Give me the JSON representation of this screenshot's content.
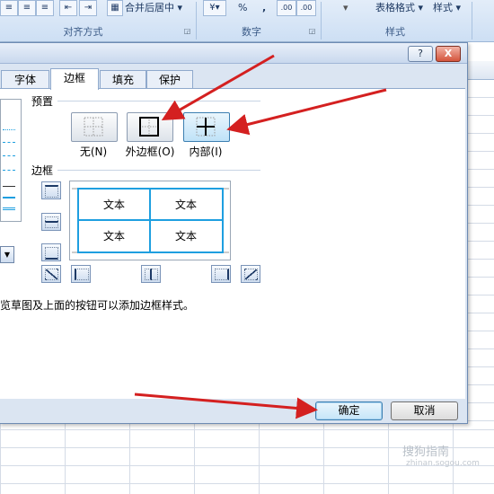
{
  "ribbon": {
    "groups": [
      {
        "label": "对齐方式"
      },
      {
        "label": "数字"
      },
      {
        "label": "样式"
      }
    ],
    "merge_center_label": "合并后居中",
    "table_format_label": "表格格式",
    "styles_label": "样式",
    "percent_label": "%",
    "comma_label": ",",
    "dec_inc_label": ".00",
    "dec_dec_label": ".00"
  },
  "dialog": {
    "help_label": "?",
    "close_label": "X",
    "tabs": [
      {
        "label": "字体"
      },
      {
        "label": "边框"
      },
      {
        "label": "填充"
      },
      {
        "label": "保护"
      }
    ],
    "presets": {
      "title": "预置",
      "items": [
        {
          "label": "无(N)"
        },
        {
          "label": "外边框(O)"
        },
        {
          "label": "内部(I)"
        }
      ]
    },
    "border": {
      "title": "边框",
      "preview_cells": [
        "文本",
        "文本",
        "文本",
        "文本"
      ]
    },
    "hint": "览草图及上面的按钮可以添加边框样式。",
    "ok_label": "确定",
    "cancel_label": "取消"
  },
  "colors": {
    "accent_blue": "#1e9fe0",
    "arrow_red": "#d42020",
    "dialog_bg": "#dbe5f2"
  },
  "watermark": {
    "text": "搜狗指南",
    "url": "zhinan.sogou.com"
  }
}
